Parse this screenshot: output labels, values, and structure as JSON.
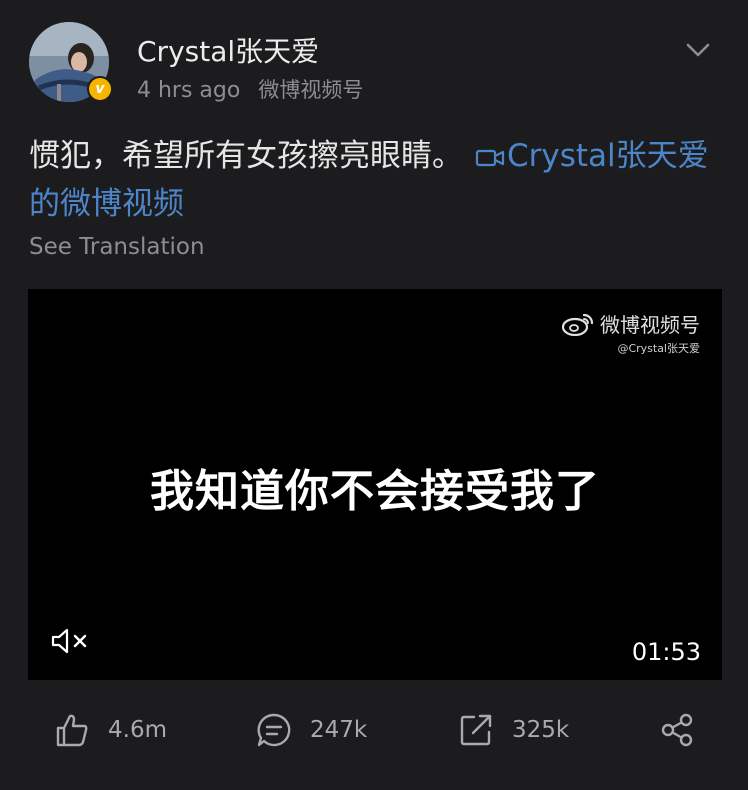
{
  "post": {
    "username": "Crystal张天爱",
    "timestamp": "4 hrs ago",
    "source": "微博视频号",
    "text": "惯犯，希望所有女孩擦亮眼睛。",
    "link_text": "Crystal张天爱的微博视频",
    "see_translation": "See Translation"
  },
  "video": {
    "watermark": "微博视频号",
    "watermark_handle": "@Crystal张天爱",
    "subtitle": "我知道你不会接受我了",
    "duration": "01:53",
    "muted": true
  },
  "actions": {
    "likes": "4.6m",
    "comments": "247k",
    "reposts": "325k"
  },
  "icons": [
    "verified-badge-icon",
    "chevron-down-icon",
    "video-camera-icon",
    "weibo-logo-icon",
    "mute-icon",
    "thumbs-up-icon",
    "comment-icon",
    "repost-icon",
    "share-icon"
  ],
  "colors": {
    "background": "#1c1c1e",
    "link": "#4d86c8",
    "verified": "#f7b500",
    "muted_text": "#8d8d92"
  }
}
